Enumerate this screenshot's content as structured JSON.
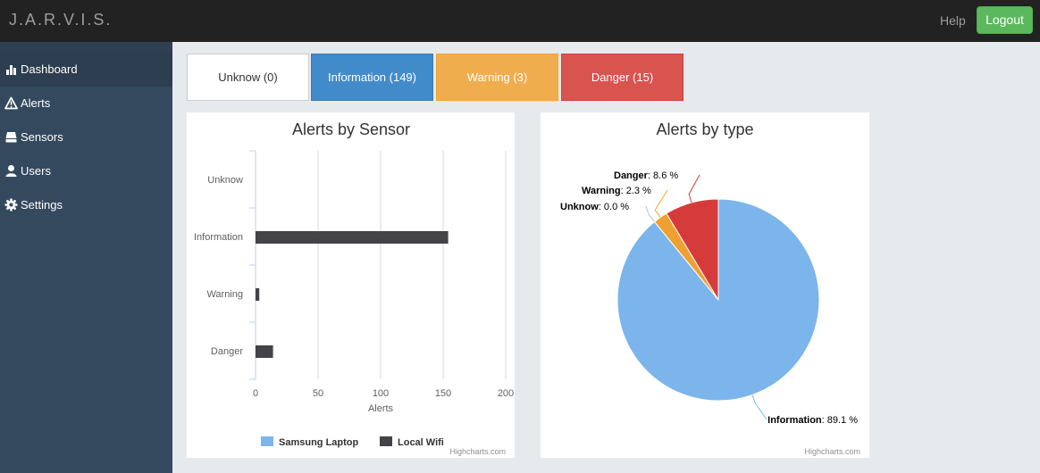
{
  "app": {
    "brand": "J.A.R.V.I.S.",
    "help_label": "Help",
    "logout_label": "Logout"
  },
  "colors": {
    "topbar": "#222222",
    "sidebar": "#34495e",
    "sidebar_active": "#2c3e50",
    "page_background": "#e7eaed",
    "unknown": "#ffffff",
    "information": "#428bca",
    "warning": "#f0ad4e",
    "danger": "#d9534f",
    "logout": "#5cb85c"
  },
  "sidebar": {
    "items": [
      {
        "label": "Dashboard",
        "icon": "bar-chart-icon",
        "active": true
      },
      {
        "label": "Alerts",
        "icon": "warning-triangle-icon",
        "active": false
      },
      {
        "label": "Sensors",
        "icon": "hdd-icon",
        "active": false
      },
      {
        "label": "Users",
        "icon": "user-icon",
        "active": false
      },
      {
        "label": "Settings",
        "icon": "gear-icon",
        "active": false
      }
    ]
  },
  "status_buttons": [
    {
      "label": "Unknow (0)",
      "kind": "unknown"
    },
    {
      "label": "Information (149)",
      "kind": "information"
    },
    {
      "label": "Warning (3)",
      "kind": "warning"
    },
    {
      "label": "Danger (15)",
      "kind": "danger"
    }
  ],
  "chart_data": [
    {
      "type": "bar",
      "orientation": "horizontal",
      "title": "Alerts by Sensor",
      "xlabel": "Alerts",
      "categories": [
        "Unknow",
        "Information",
        "Warning",
        "Danger"
      ],
      "xlim": [
        0,
        200
      ],
      "ticks": [
        0,
        50,
        100,
        150,
        200
      ],
      "grid": true,
      "legend_position": "bottom",
      "series": [
        {
          "name": "Samsung Laptop",
          "color": "#7cb5ec",
          "values": [
            0,
            0,
            0,
            0
          ]
        },
        {
          "name": "Local Wifi",
          "color": "#434348",
          "values": [
            0,
            154,
            3,
            14
          ]
        }
      ],
      "credits": "Highcharts.com"
    },
    {
      "type": "pie",
      "title": "Alerts by type",
      "slices": [
        {
          "name": "Information",
          "value": 89.1,
          "label": "89.1 %",
          "color": "#7cb5ec"
        },
        {
          "name": "Unknow",
          "value": 0.0,
          "label": "0.0 %",
          "color": "#90ed7d"
        },
        {
          "name": "Warning",
          "value": 2.3,
          "label": "2.3 %",
          "color": "#f0a030"
        },
        {
          "name": "Danger",
          "value": 8.6,
          "label": "8.6 %",
          "color": "#d63b3b"
        }
      ],
      "credits": "Highcharts.com"
    }
  ]
}
